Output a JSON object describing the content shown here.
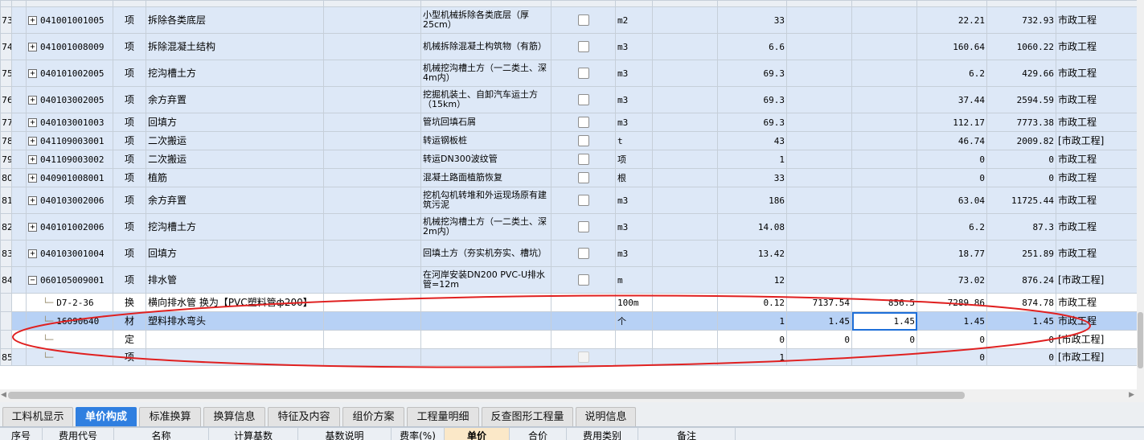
{
  "rows": [
    {
      "rn": "73",
      "code": "041001001005",
      "type": "项",
      "name": "拆除各类底层",
      "feat": "小型机械拆除各类底层（厚25cm）",
      "unit": "m2",
      "qty": "33",
      "price1": "",
      "price2": "",
      "uprice": "22.21",
      "total": "732.93",
      "cat": "市政工程"
    },
    {
      "rn": "74",
      "code": "041001008009",
      "type": "项",
      "name": "拆除混凝土结构",
      "feat": "机械拆除混凝土构筑物（有筋）",
      "unit": "m3",
      "qty": "6.6",
      "price1": "",
      "price2": "",
      "uprice": "160.64",
      "total": "1060.22",
      "cat": "市政工程"
    },
    {
      "rn": "75",
      "code": "040101002005",
      "type": "项",
      "name": "挖沟槽土方",
      "feat": "机械挖沟槽土方（一二类土、深4m内）",
      "unit": "m3",
      "qty": "69.3",
      "price1": "",
      "price2": "",
      "uprice": "6.2",
      "total": "429.66",
      "cat": "市政工程"
    },
    {
      "rn": "76",
      "code": "040103002005",
      "type": "项",
      "name": "余方弃置",
      "feat": "挖掘机装土、自卸汽车运土方（15km）",
      "unit": "m3",
      "qty": "69.3",
      "price1": "",
      "price2": "",
      "uprice": "37.44",
      "total": "2594.59",
      "cat": "市政工程"
    },
    {
      "rn": "77",
      "code": "040103001003",
      "type": "项",
      "name": "回填方",
      "feat": "管坑回填石屑",
      "unit": "m3",
      "qty": "69.3",
      "price1": "",
      "price2": "",
      "uprice": "112.17",
      "total": "7773.38",
      "cat": "市政工程"
    },
    {
      "rn": "78",
      "code": "041109003001",
      "type": "项",
      "name": "二次搬运",
      "feat": "转运钢板桩",
      "unit": "t",
      "qty": "43",
      "price1": "",
      "price2": "",
      "uprice": "46.74",
      "total": "2009.82",
      "cat": "[市政工程]"
    },
    {
      "rn": "79",
      "code": "041109003002",
      "type": "项",
      "name": "二次搬运",
      "feat": "转运DN300波纹管",
      "unit": "项",
      "qty": "1",
      "price1": "",
      "price2": "",
      "uprice": "0",
      "total": "0",
      "cat": "市政工程"
    },
    {
      "rn": "80",
      "code": "040901008001",
      "type": "项",
      "name": "植筋",
      "feat": "混凝土路面植筋恢复",
      "unit": "根",
      "qty": "33",
      "price1": "",
      "price2": "",
      "uprice": "0",
      "total": "0",
      "cat": "市政工程"
    },
    {
      "rn": "81",
      "code": "040103002006",
      "type": "项",
      "name": "余方弃置",
      "feat": "挖机勾机转堆和外运现场原有建筑污泥",
      "unit": "m3",
      "qty": "186",
      "price1": "",
      "price2": "",
      "uprice": "63.04",
      "total": "11725.44",
      "cat": "市政工程"
    },
    {
      "rn": "82",
      "code": "040101002006",
      "type": "项",
      "name": "挖沟槽土方",
      "feat": "机械挖沟槽土方（一二类土、深2m内）",
      "unit": "m3",
      "qty": "14.08",
      "price1": "",
      "price2": "",
      "uprice": "6.2",
      "total": "87.3",
      "cat": "市政工程"
    },
    {
      "rn": "83",
      "code": "040103001004",
      "type": "项",
      "name": "回填方",
      "feat": "回填土方（夯实机夯实、槽坑）",
      "unit": "m3",
      "qty": "13.42",
      "price1": "",
      "price2": "",
      "uprice": "18.77",
      "total": "251.89",
      "cat": "市政工程"
    },
    {
      "rn": "84",
      "code": "060105009001",
      "type": "项",
      "name": "排水管",
      "feat": "在河岸安装DN200 PVC-U排水管=12m",
      "unit": "m",
      "qty": "12",
      "price1": "",
      "price2": "",
      "uprice": "73.02",
      "total": "876.24",
      "cat": "[市政工程]"
    }
  ],
  "children": [
    {
      "code": "D7-2-36",
      "type": "换",
      "name": "横向排水管  换为【PVC塑料管ф200】",
      "unit": "100m",
      "qty": "0.12",
      "price1": "7137.54",
      "price2": "856.5",
      "uprice": "7289.86",
      "total": "874.78",
      "cat": "市政工程"
    },
    {
      "code": "16090640",
      "type": "材",
      "name": "塑料排水弯头",
      "unit": "个",
      "qty": "1",
      "price1": "1.45",
      "price2": "1.45",
      "uprice": "1.45",
      "total": "1.45",
      "cat": "市政工程"
    },
    {
      "code": "",
      "type": "定",
      "name": "",
      "unit": "",
      "qty": "0",
      "price1": "0",
      "price2": "0",
      "uprice": "0",
      "total": "0",
      "cat": "[市政工程]"
    }
  ],
  "last_row": {
    "rn": "85",
    "type": "项",
    "qty": "1",
    "uprice": "0",
    "total": "0",
    "cat": "[市政工程]"
  },
  "tabs": [
    "工料机显示",
    "单价构成",
    "标准换算",
    "换算信息",
    "特征及内容",
    "组价方案",
    "工程量明细",
    "反查图形工程量",
    "说明信息"
  ],
  "active_tab": "单价构成",
  "sub_headers": [
    "序号",
    "费用代号",
    "名称",
    "计算基数",
    "基数说明",
    "费率(%)",
    "单价",
    "合价",
    "费用类别",
    "备注"
  ],
  "colors": {
    "row_bg": "#dde8f7",
    "selected_bg": "#b7d1f5",
    "tab_active": "#2f7fe0",
    "annotation": "#e02020"
  }
}
